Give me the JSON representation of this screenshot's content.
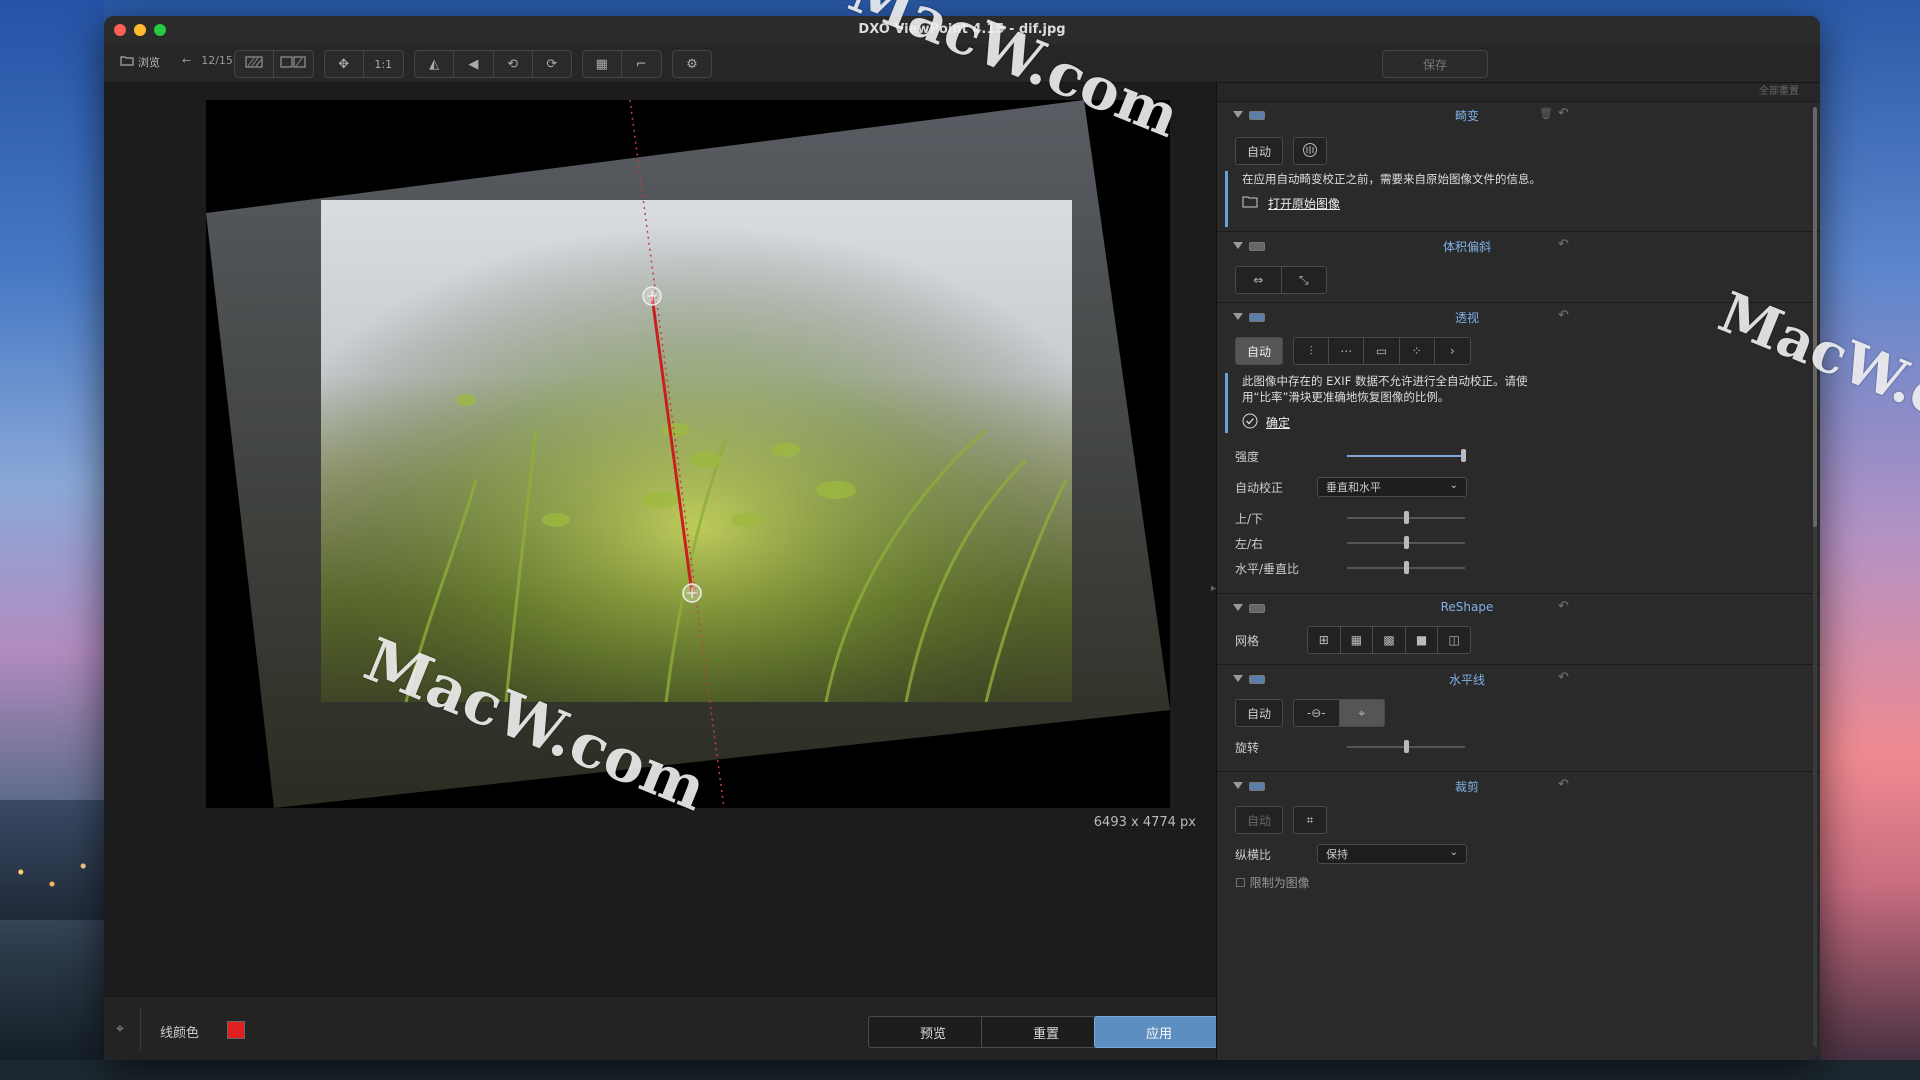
{
  "window": {
    "title": "DXO ViewPoint 4.15 - dif.jpg"
  },
  "toolbar": {
    "browse_label": "浏览",
    "counter": "12/15",
    "one_to_one": "1:1",
    "save_label": "保存"
  },
  "canvas": {
    "image_dims": "6493 x 4774 px"
  },
  "bottom": {
    "line_color_label": "线颜色",
    "line_color": "#e02020",
    "preview_label": "预览",
    "reset_label": "重置",
    "apply_label": "应用"
  },
  "panel": {
    "reset_all": "全部重置",
    "distortion": {
      "title": "畸变",
      "auto_label": "自动",
      "info_text": "在应用自动畸变校正之前，需要来自原始图像文件的信息。",
      "open_original": "打开原始图像"
    },
    "volume": {
      "title": "体积偏斜"
    },
    "perspective": {
      "title": "透视",
      "auto_label": "自动",
      "info_text": "此图像中存在的 EXIF 数据不允许进行全自动校正。请使用“比率”滑块更准确地恢复图像的比例。",
      "confirm": "确定",
      "strength_label": "强度",
      "strength": 0.99,
      "auto_correct_label": "自动校正",
      "auto_correct_value": "垂直和水平",
      "updown_label": "上/下",
      "updown": 0.5,
      "leftright_label": "左/右",
      "leftright": 0.5,
      "ratio_label": "水平/垂直比",
      "ratio": 0.5
    },
    "reshape": {
      "title": "ReShape",
      "grid_label": "网格"
    },
    "horizon": {
      "title": "水平线",
      "auto_label": "自动",
      "rotate_label": "旋转",
      "rotate": 0.5
    },
    "crop": {
      "title": "裁剪",
      "auto_label": "自动",
      "aspect_label": "纵横比",
      "aspect_value": "保持",
      "limit_label": "限制为图像"
    }
  },
  "watermarks": [
    "MacW.com",
    "MacW.com",
    "MacW.com"
  ]
}
